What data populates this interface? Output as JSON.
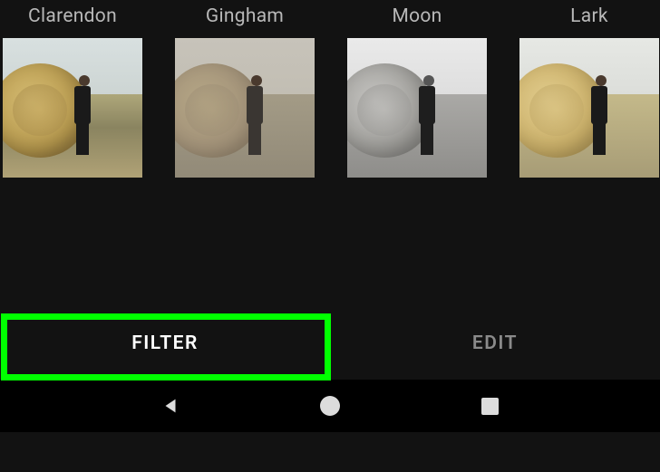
{
  "filters": [
    {
      "name": "Clarendon",
      "class": "f-clarendon"
    },
    {
      "name": "Gingham",
      "class": "f-gingham"
    },
    {
      "name": "Moon",
      "class": "f-moon"
    },
    {
      "name": "Lark",
      "class": "f-lark"
    }
  ],
  "tabs": {
    "filter": "FILTER",
    "edit": "EDIT"
  },
  "active_tab": "filter",
  "highlight_color": "#00ff00"
}
